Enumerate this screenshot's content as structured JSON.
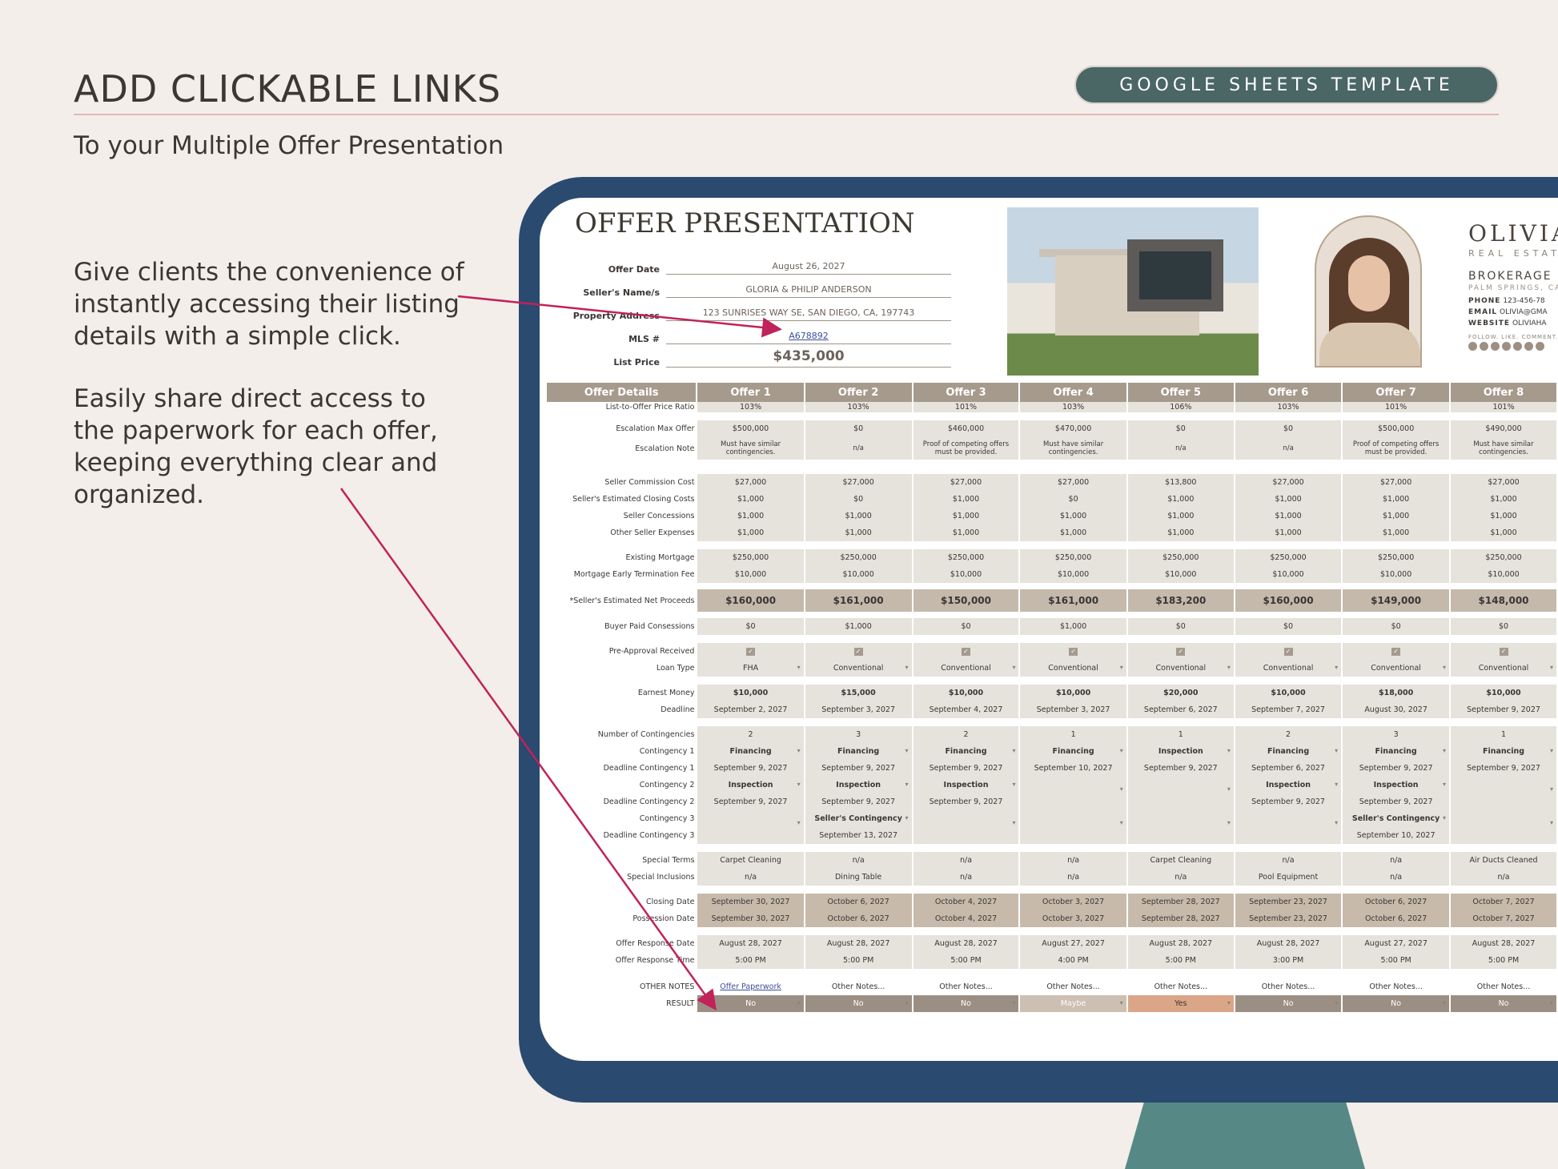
{
  "header": {
    "title": "ADD CLICKABLE LINKS",
    "subtitle": "To your Multiple Offer Presentation",
    "badge": "GOOGLE SHEETS TEMPLATE"
  },
  "callouts": {
    "p1": "Give clients the convenience of instantly accessing their listing details with a simple click.",
    "p2": "Easily share direct access to the paperwork for each offer, keeping everything clear and organized."
  },
  "sheet": {
    "title": "OFFER PRESENTATION",
    "info": {
      "offer_date_label": "Offer Date",
      "offer_date": "August 26, 2027",
      "seller_label": "Seller's Name/s",
      "seller": "GLORIA & PHILIP ANDERSON",
      "address_label": "Property Address",
      "address": "123 SUNRISES WAY SE, SAN DIEGO, CA, 197743",
      "mls_label": "MLS #",
      "mls": "A678892",
      "price_label": "List Price",
      "price": "$435,000"
    },
    "brand": {
      "name": "OLIVIA",
      "sub": "REAL ESTAT",
      "brokerage": "BROKERAGE",
      "location": "PALM SPRINGS, CA",
      "phone_label": "PHONE",
      "phone": "123-456-78",
      "email_label": "EMAIL",
      "email": "OLIVIA@GMA",
      "website_label": "WEBSITE",
      "website": "OLIVIAHA",
      "follow": "FOLLOW. LIKE. COMMENT. SH"
    },
    "columns": [
      "Offer Details",
      "Offer 1",
      "Offer 2",
      "Offer 3",
      "Offer 4",
      "Offer 5",
      "Offer 6",
      "Offer 7",
      "Offer 8"
    ],
    "rows": {
      "ltop": {
        "label": "List-to-Offer Price Ratio",
        "v": [
          "103%",
          "103%",
          "101%",
          "103%",
          "106%",
          "103%",
          "101%",
          "101%"
        ]
      },
      "esc_max": {
        "label": "Escalation Max Offer",
        "v": [
          "$500,000",
          "$0",
          "$460,000",
          "$470,000",
          "$0",
          "$0",
          "$500,000",
          "$490,000"
        ]
      },
      "esc_note": {
        "label": "Escalation Note",
        "v": [
          "Must have similar contingencies.",
          "n/a",
          "Proof of competing offers must be provided.",
          "Must have similar contingencies.",
          "n/a",
          "n/a",
          "Proof of competing offers must be provided.",
          "Must have similar contingencies."
        ]
      },
      "commission": {
        "label": "Seller Commission Cost",
        "v": [
          "$27,000",
          "$27,000",
          "$27,000",
          "$27,000",
          "$13,800",
          "$27,000",
          "$27,000",
          "$27,000"
        ]
      },
      "closing_costs": {
        "label": "Seller's Estimated Closing Costs",
        "v": [
          "$1,000",
          "$0",
          "$1,000",
          "$0",
          "$1,000",
          "$1,000",
          "$1,000",
          "$1,000"
        ]
      },
      "concessions": {
        "label": "Seller Concessions",
        "v": [
          "$1,000",
          "$1,000",
          "$1,000",
          "$1,000",
          "$1,000",
          "$1,000",
          "$1,000",
          "$1,000"
        ]
      },
      "other_exp": {
        "label": "Other Seller Expenses",
        "v": [
          "$1,000",
          "$1,000",
          "$1,000",
          "$1,000",
          "$1,000",
          "$1,000",
          "$1,000",
          "$1,000"
        ]
      },
      "mortgage": {
        "label": "Existing Mortgage",
        "v": [
          "$250,000",
          "$250,000",
          "$250,000",
          "$250,000",
          "$250,000",
          "$250,000",
          "$250,000",
          "$250,000"
        ]
      },
      "early_term": {
        "label": "Mortgage Early Termination Fee",
        "v": [
          "$10,000",
          "$10,000",
          "$10,000",
          "$10,000",
          "$10,000",
          "$10,000",
          "$10,000",
          "$10,000"
        ]
      },
      "net": {
        "label": "*Seller's Estimated Net Proceeds",
        "v": [
          "$160,000",
          "$161,000",
          "$150,000",
          "$161,000",
          "$183,200",
          "$160,000",
          "$149,000",
          "$148,000"
        ]
      },
      "buyer_conc": {
        "label": "Buyer Paid Consessions",
        "v": [
          "$0",
          "$1,000",
          "$0",
          "$1,000",
          "$0",
          "$0",
          "$0",
          "$0"
        ]
      },
      "preapproval": {
        "label": "Pre-Approval Received",
        "v": [
          "✓",
          "✓",
          "✓",
          "✓",
          "✓",
          "✓",
          "✓",
          "✓"
        ]
      },
      "loan_type": {
        "label": "Loan Type",
        "v": [
          "FHA",
          "Conventional",
          "Conventional",
          "Conventional",
          "Conventional",
          "Conventional",
          "Conventional",
          "Conventional"
        ]
      },
      "earnest": {
        "label": "Earnest Money",
        "v": [
          "$10,000",
          "$15,000",
          "$10,000",
          "$10,000",
          "$20,000",
          "$10,000",
          "$18,000",
          "$10,000"
        ]
      },
      "deadline": {
        "label": "Deadline",
        "v": [
          "September 2, 2027",
          "September 3, 2027",
          "September 4, 2027",
          "September 3, 2027",
          "September 6, 2027",
          "September 7, 2027",
          "August 30, 2027",
          "September 9, 2027"
        ]
      },
      "num_cont": {
        "label": "Number of Contingencies",
        "v": [
          "2",
          "3",
          "2",
          "1",
          "1",
          "2",
          "3",
          "1"
        ]
      },
      "cont1": {
        "label": "Contingency 1",
        "v": [
          "Financing",
          "Financing",
          "Financing",
          "Financing",
          "Inspection",
          "Financing",
          "Financing",
          "Financing"
        ]
      },
      "dl_cont1": {
        "label": "Deadline Contingency 1",
        "v": [
          "September 9, 2027",
          "September 9, 2027",
          "September 9, 2027",
          "September 10, 2027",
          "September 9, 2027",
          "September 6, 2027",
          "September 9, 2027",
          "September 9, 2027"
        ]
      },
      "cont2": {
        "label": "Contingency 2",
        "v": [
          "Inspection",
          "Inspection",
          "Inspection",
          "",
          "",
          "Inspection",
          "Inspection",
          ""
        ]
      },
      "dl_cont2": {
        "label": "Deadline Contingency 2",
        "v": [
          "September 9, 2027",
          "September 9, 2027",
          "September 9, 2027",
          "",
          "",
          "September 9, 2027",
          "September 9, 2027",
          ""
        ]
      },
      "cont3": {
        "label": "Contingency 3",
        "v": [
          "",
          "Seller's Contingency",
          "",
          "",
          "",
          "",
          "Seller's Contingency",
          ""
        ]
      },
      "dl_cont3": {
        "label": "Deadline Contingency 3",
        "v": [
          "",
          "September 13, 2027",
          "",
          "",
          "",
          "",
          "September 10, 2027",
          ""
        ]
      },
      "special_terms": {
        "label": "Special Terms",
        "v": [
          "Carpet Cleaning",
          "n/a",
          "n/a",
          "n/a",
          "Carpet Cleaning",
          "n/a",
          "n/a",
          "Air Ducts Cleaned"
        ]
      },
      "special_incl": {
        "label": "Special Inclusions",
        "v": [
          "n/a",
          "Dining Table",
          "n/a",
          "n/a",
          "n/a",
          "Pool Equipment",
          "n/a",
          "n/a"
        ]
      },
      "closing_date": {
        "label": "Closing Date",
        "v": [
          "September 30, 2027",
          "October 6, 2027",
          "October 4, 2027",
          "October 3, 2027",
          "September 28, 2027",
          "September 23, 2027",
          "October 6, 2027",
          "October 7, 2027"
        ]
      },
      "possession": {
        "label": "Possession Date",
        "v": [
          "September 30, 2027",
          "October 6, 2027",
          "October 4, 2027",
          "October 3, 2027",
          "September 28, 2027",
          "September 23, 2027",
          "October 6, 2027",
          "October 7, 2027"
        ]
      },
      "resp_date": {
        "label": "Offer Response Date",
        "v": [
          "August 28, 2027",
          "August 28, 2027",
          "August 28, 2027",
          "August 27, 2027",
          "August 28, 2027",
          "August 28, 2027",
          "August 27, 2027",
          "August 28, 2027"
        ]
      },
      "resp_time": {
        "label": "Offer Response Time",
        "v": [
          "5:00 PM",
          "5:00 PM",
          "5:00 PM",
          "4:00 PM",
          "5:00 PM",
          "3:00 PM",
          "5:00 PM",
          "5:00 PM"
        ]
      },
      "notes": {
        "label": "OTHER NOTES",
        "v": [
          "Offer Paperwork",
          "Other Notes...",
          "Other Notes...",
          "Other Notes...",
          "Other Notes...",
          "Other Notes...",
          "Other Notes...",
          "Other Notes..."
        ]
      },
      "result": {
        "label": "RESULT",
        "v": [
          "No",
          "No",
          "No",
          "Maybe",
          "Yes",
          "No",
          "No",
          "No"
        ]
      }
    }
  },
  "colors": {
    "background": "#f3eeea",
    "monitor": "#2a4a6f",
    "stand": "#568986",
    "badge": "#4a6665",
    "rule": "#e4b8b2",
    "header_cell": "#a69a8d",
    "arrow": "#c0225a"
  }
}
